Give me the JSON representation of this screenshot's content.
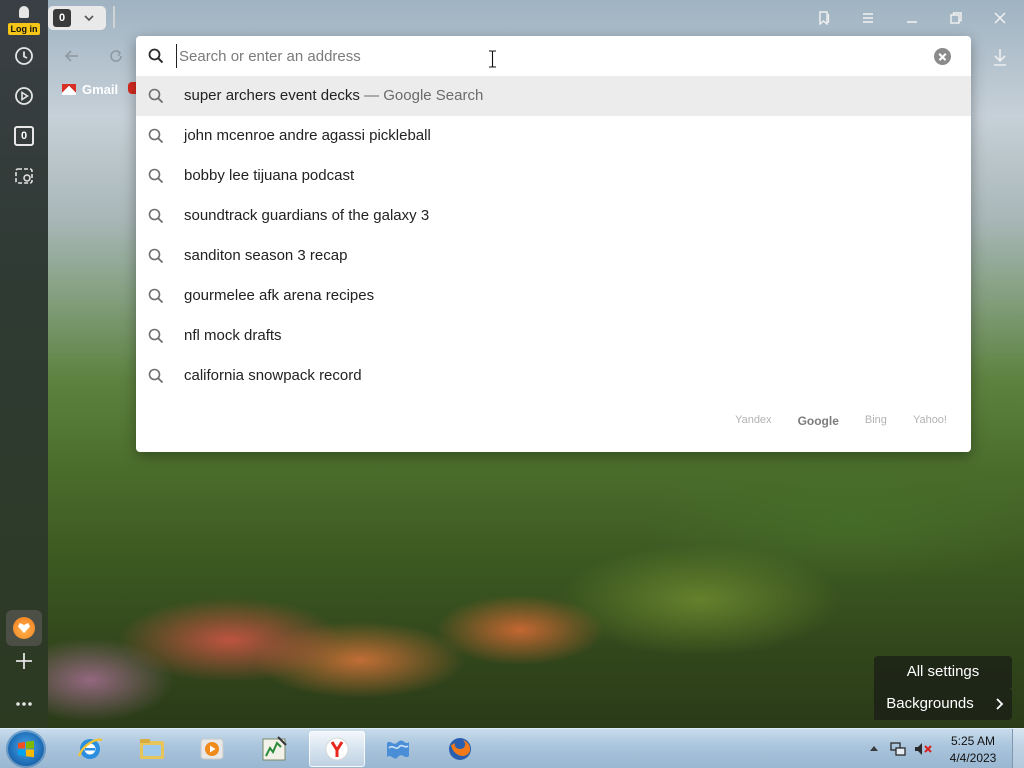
{
  "sidebar": {
    "login_label": "Log in",
    "tabs_badge": "0",
    "icons": [
      "history-icon",
      "play-icon",
      "tabs-counter-icon",
      "screenshot-icon",
      "favorites-widget-icon",
      "add-icon",
      "more-icon"
    ]
  },
  "toolbar": {
    "tab_count": "0"
  },
  "bookmarks": {
    "gmail_label": "Gmail"
  },
  "omnibox": {
    "placeholder": "Search or enter an address",
    "value": "",
    "suggestions": [
      {
        "text": "super archers event decks",
        "suffix": " — Google Search"
      },
      {
        "text": "john mcenroe andre agassi pickleball",
        "suffix": ""
      },
      {
        "text": "bobby lee tijuana podcast",
        "suffix": ""
      },
      {
        "text": "soundtrack guardians of the galaxy 3",
        "suffix": ""
      },
      {
        "text": "sanditon season 3 recap",
        "suffix": ""
      },
      {
        "text": "gourmelee afk arena recipes",
        "suffix": ""
      },
      {
        "text": "nfl mock drafts",
        "suffix": ""
      },
      {
        "text": "california snowpack record",
        "suffix": ""
      }
    ],
    "engines": [
      "Yandex",
      "Google",
      "Bing",
      "Yahoo!"
    ],
    "selected_engine": "Google"
  },
  "corner": {
    "all_settings": "All settings",
    "backgrounds": "Backgrounds"
  },
  "taskbar": {
    "time": "5:25 AM",
    "date": "4/4/2023"
  }
}
